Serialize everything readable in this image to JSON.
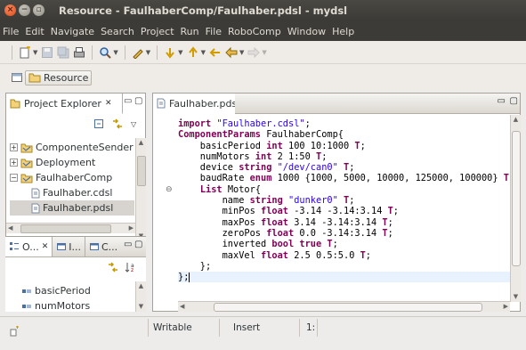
{
  "window": {
    "title": "Resource - FaulhaberComp/Faulhaber.pdsl - mydsl"
  },
  "menubar": {
    "items": [
      "File",
      "Edit",
      "Navigate",
      "Search",
      "Project",
      "Run",
      "File",
      "RoboComp",
      "Window",
      "Help"
    ]
  },
  "breadcrumb": {
    "label": "Resource"
  },
  "project_explorer": {
    "tab_label": "Project Explorer",
    "tab_close": "✕",
    "items": [
      {
        "label": "ComponenteSender",
        "expander": "+",
        "icon": "project-folder-icon"
      },
      {
        "label": "Deployment",
        "expander": "+",
        "icon": "project-folder-icon"
      },
      {
        "label": "FaulhaberComp",
        "expander": "−",
        "icon": "project-folder-icon"
      },
      {
        "label": "Faulhaber.cdsl",
        "icon": "file-icon"
      },
      {
        "label": "Faulhaber.pdsl",
        "icon": "file-icon",
        "selected": true
      }
    ]
  },
  "outline_panel": {
    "tabs": [
      {
        "label": "O...",
        "close": "✕"
      },
      {
        "label": "I..."
      },
      {
        "label": "C..."
      }
    ],
    "items": [
      "basicPeriod",
      "numMotors"
    ]
  },
  "editor": {
    "tab_label": "Faulhaber.pdsl",
    "tab_close": "✕",
    "code": [
      {
        "tokens": [
          {
            "t": "kw",
            "v": "import"
          },
          {
            "t": "plain",
            "v": " "
          },
          {
            "t": "str",
            "v": "\"Faulhaber.cdsl\""
          },
          {
            "t": "plain",
            "v": ";"
          }
        ]
      },
      {
        "tokens": [
          {
            "t": "kw",
            "v": "ComponentParams"
          },
          {
            "t": "plain",
            "v": " FaulhaberComp{"
          }
        ]
      },
      {
        "tokens": [
          {
            "t": "plain",
            "v": "    basicPeriod "
          },
          {
            "t": "kw",
            "v": "int"
          },
          {
            "t": "plain",
            "v": " 100 10:1000 "
          },
          {
            "t": "kw",
            "v": "T"
          },
          {
            "t": "plain",
            "v": ";"
          }
        ]
      },
      {
        "tokens": [
          {
            "t": "plain",
            "v": "    numMotors "
          },
          {
            "t": "kw",
            "v": "int"
          },
          {
            "t": "plain",
            "v": " 2 1:50 "
          },
          {
            "t": "kw",
            "v": "T"
          },
          {
            "t": "plain",
            "v": ";"
          }
        ]
      },
      {
        "tokens": [
          {
            "t": "plain",
            "v": "    device "
          },
          {
            "t": "kw",
            "v": "string"
          },
          {
            "t": "plain",
            "v": " "
          },
          {
            "t": "str",
            "v": "\"/dev/can0\""
          },
          {
            "t": "plain",
            "v": " "
          },
          {
            "t": "kw",
            "v": "T"
          },
          {
            "t": "plain",
            "v": ";"
          }
        ]
      },
      {
        "tokens": [
          {
            "t": "plain",
            "v": "    baudRate "
          },
          {
            "t": "kw",
            "v": "enum"
          },
          {
            "t": "plain",
            "v": " 1000 {1000, 5000, 10000, 125000, 100000} "
          },
          {
            "t": "kw",
            "v": "T"
          },
          {
            "t": "plain",
            "v": ";"
          }
        ]
      },
      {
        "tokens": [
          {
            "t": "plain",
            "v": "    "
          },
          {
            "t": "kw",
            "v": "List"
          },
          {
            "t": "plain",
            "v": " Motor{"
          }
        ],
        "fold": "⊖"
      },
      {
        "tokens": [
          {
            "t": "plain",
            "v": "        name "
          },
          {
            "t": "kw",
            "v": "string"
          },
          {
            "t": "plain",
            "v": " "
          },
          {
            "t": "str",
            "v": "\"dunker0\""
          },
          {
            "t": "plain",
            "v": " "
          },
          {
            "t": "kw",
            "v": "T"
          },
          {
            "t": "plain",
            "v": ";"
          }
        ]
      },
      {
        "tokens": [
          {
            "t": "plain",
            "v": "        minPos "
          },
          {
            "t": "kw",
            "v": "float"
          },
          {
            "t": "plain",
            "v": " -3.14 -3.14:3.14 "
          },
          {
            "t": "kw",
            "v": "T"
          },
          {
            "t": "plain",
            "v": ";"
          }
        ]
      },
      {
        "tokens": [
          {
            "t": "plain",
            "v": "        maxPos "
          },
          {
            "t": "kw",
            "v": "float"
          },
          {
            "t": "plain",
            "v": " 3.14 -3.14:3.14 "
          },
          {
            "t": "kw",
            "v": "T"
          },
          {
            "t": "plain",
            "v": ";"
          }
        ]
      },
      {
        "tokens": [
          {
            "t": "plain",
            "v": "        zeroPos "
          },
          {
            "t": "kw",
            "v": "float"
          },
          {
            "t": "plain",
            "v": " 0.0 -3.14:3.14 "
          },
          {
            "t": "kw",
            "v": "T"
          },
          {
            "t": "plain",
            "v": ";"
          }
        ]
      },
      {
        "tokens": [
          {
            "t": "plain",
            "v": "        inverted "
          },
          {
            "t": "kw",
            "v": "bool"
          },
          {
            "t": "plain",
            "v": " "
          },
          {
            "t": "kw",
            "v": "true"
          },
          {
            "t": "plain",
            "v": " "
          },
          {
            "t": "kw",
            "v": "T"
          },
          {
            "t": "plain",
            "v": ";"
          }
        ]
      },
      {
        "tokens": [
          {
            "t": "plain",
            "v": "        maxVel "
          },
          {
            "t": "kw",
            "v": "float"
          },
          {
            "t": "plain",
            "v": " 2.5 0.5:5.0 "
          },
          {
            "t": "kw",
            "v": "T"
          },
          {
            "t": "plain",
            "v": ";"
          }
        ]
      },
      {
        "tokens": [
          {
            "t": "plain",
            "v": "    };"
          }
        ]
      },
      {
        "tokens": [
          {
            "t": "plain",
            "v": "};"
          }
        ],
        "cursor": true
      }
    ]
  },
  "status": {
    "writable": "Writable",
    "insert": "Insert",
    "position": "1:"
  },
  "colors": {
    "keyword": "#7f0055",
    "string": "#2a00ff",
    "titlebar": "#3c3b37",
    "close_button": "#df4a16"
  }
}
